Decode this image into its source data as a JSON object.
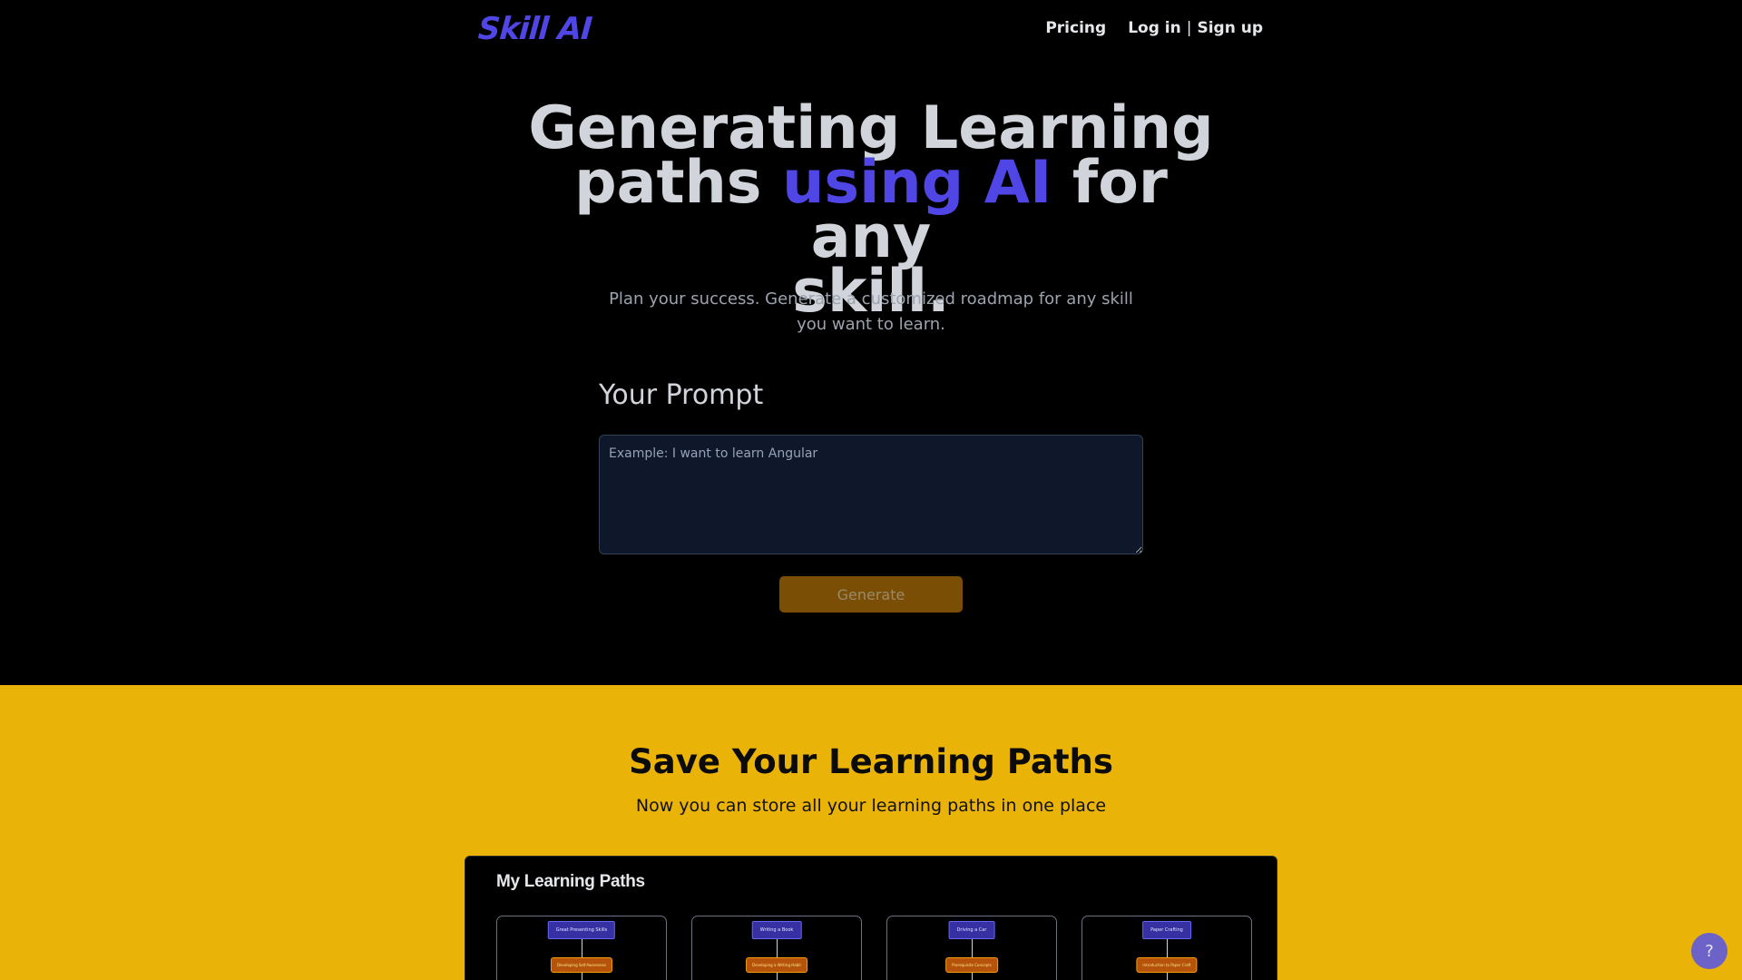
{
  "nav": {
    "logo": "Skill AI",
    "pricing": "Pricing",
    "login": "Log in",
    "separator": "|",
    "signup": "Sign up"
  },
  "hero": {
    "title_line1": "Generating Learning",
    "title_line2_start": "paths ",
    "title_line2_accent": "using AI",
    "title_line2_end": " for any",
    "title_line3": "skill.",
    "subtitle": "Plan your success. Generate a customized roadmap for any skill you want to learn."
  },
  "prompt": {
    "label": "Your Prompt",
    "placeholder": "Example: I want to learn Angular",
    "value": "",
    "button": "Generate"
  },
  "save_section": {
    "title": "Save Your Learning Paths",
    "subtitle": "Now you can store all your learning paths in one place"
  },
  "learning_paths": {
    "title": "My Learning Paths",
    "cards": [
      {
        "top": "Great Presenting Skills",
        "mid": "Developing Self-Awareness"
      },
      {
        "top": "Writing a Book",
        "mid": "Developing a Writing Habit"
      },
      {
        "top": "Driving a Car",
        "mid": "Prerequisite Concepts"
      },
      {
        "top": "Paper Crafting",
        "mid": "Introduction to Paper Craft"
      }
    ]
  },
  "help": {
    "label": "?"
  },
  "colors": {
    "accent": "#4f46e5",
    "yellow": "#eab308",
    "generate_button": "#7a4f05"
  }
}
